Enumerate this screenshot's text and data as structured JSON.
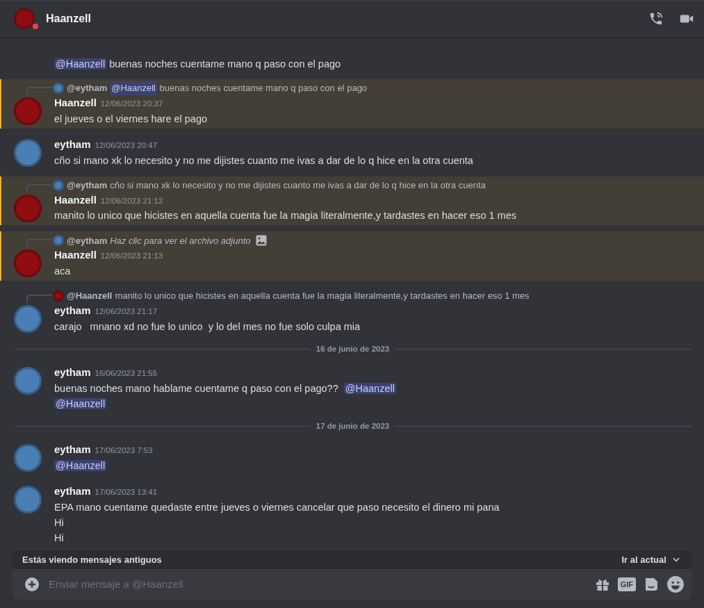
{
  "header": {
    "name": "Haanzell"
  },
  "messages": [
    {
      "kind": "continuation",
      "highlighted": false,
      "segments": [
        {
          "kind": "mention",
          "text": "@Haanzell"
        },
        {
          "kind": "text",
          "text": " buenas noches cuentame mano q paso con el pago"
        }
      ]
    },
    {
      "kind": "message",
      "highlighted": true,
      "avatar": {
        "color": "#8f0d10"
      },
      "author": "Haanzell",
      "timestamp": "12/06/2023 20:37",
      "reply": {
        "avatar": {
          "color": "#4a7fb5"
        },
        "author": "@eytham",
        "segments": [
          {
            "kind": "mention",
            "text": "@Haanzell"
          },
          {
            "kind": "text",
            "text": " buenas noches cuentame mano q paso con el pago"
          }
        ]
      },
      "lines": [
        [
          {
            "kind": "text",
            "text": "el jueves o el viernes hare el pago"
          }
        ]
      ]
    },
    {
      "kind": "message",
      "highlighted": false,
      "avatar": {
        "color": "#4a7fb5"
      },
      "author": "eytham",
      "timestamp": "12/06/2023 20:47",
      "lines": [
        [
          {
            "kind": "text",
            "text": "cño si mano xk lo necesito y no me dijistes cuanto me ivas a dar de lo q hice en la otra cuenta"
          }
        ]
      ]
    },
    {
      "kind": "message",
      "highlighted": true,
      "avatar": {
        "color": "#8f0d10"
      },
      "author": "Haanzell",
      "timestamp": "12/06/2023 21:12",
      "reply": {
        "avatar": {
          "color": "#4a7fb5"
        },
        "author": "@eytham",
        "segments": [
          {
            "kind": "text",
            "text": "cño si mano xk lo necesito y no me dijistes cuanto me ivas a dar de lo q hice en la otra cuenta"
          }
        ]
      },
      "lines": [
        [
          {
            "kind": "text",
            "text": "manito lo unico que hicistes en aquella cuenta fue la magia literalmente,y tardastes en hacer eso 1 mes"
          }
        ]
      ]
    },
    {
      "kind": "message",
      "highlighted": true,
      "avatar": {
        "color": "#8f0d10"
      },
      "author": "Haanzell",
      "timestamp": "12/06/2023 21:13",
      "reply": {
        "avatar": {
          "color": "#4a7fb5"
        },
        "author": "@eytham",
        "attachment_icon": true,
        "segments": [
          {
            "kind": "italic",
            "text": "Haz clic para ver el archivo adjunto"
          }
        ]
      },
      "lines": [
        [
          {
            "kind": "text",
            "text": "aca"
          }
        ]
      ]
    },
    {
      "kind": "message",
      "highlighted": false,
      "avatar": {
        "color": "#4a7fb5"
      },
      "author": "eytham",
      "timestamp": "12/06/2023 21:17",
      "reply": {
        "avatar": {
          "color": "#8f0d10"
        },
        "author": "@Haanzell",
        "segments": [
          {
            "kind": "text",
            "text": "manito lo unico que hicistes en aquella cuenta fue la magia literalmente,y tardastes en hacer eso 1 mes"
          }
        ]
      },
      "lines": [
        [
          {
            "kind": "text",
            "text": "carajo   mnano xd no fue lo unico  y lo del mes no fue solo culpa mia"
          }
        ]
      ]
    },
    {
      "kind": "divider",
      "text": "16 de junio de 2023"
    },
    {
      "kind": "message",
      "highlighted": false,
      "avatar": {
        "color": "#4a7fb5"
      },
      "author": "eytham",
      "timestamp": "16/06/2023 21:55",
      "lines": [
        [
          {
            "kind": "text",
            "text": "buenas noches mano hablame cuentame q paso con el pago??  "
          },
          {
            "kind": "mention",
            "text": "@Haanzell"
          }
        ],
        [
          {
            "kind": "mention",
            "text": "@Haanzell"
          }
        ]
      ]
    },
    {
      "kind": "divider",
      "text": "17 de junio de 2023"
    },
    {
      "kind": "message",
      "highlighted": false,
      "avatar": {
        "color": "#4a7fb5"
      },
      "author": "eytham",
      "timestamp": "17/06/2023 7:53",
      "lines": [
        [
          {
            "kind": "mention",
            "text": "@Haanzell"
          }
        ]
      ]
    },
    {
      "kind": "message",
      "highlighted": false,
      "avatar": {
        "color": "#4a7fb5"
      },
      "author": "eytham",
      "timestamp": "17/06/2023 13:41",
      "lines": [
        [
          {
            "kind": "text",
            "text": "EPA mano cuentame quedaste entre jueves o viernes cancelar que paso necesito el dinero mi pana"
          }
        ],
        [
          {
            "kind": "text",
            "text": "Hi"
          }
        ],
        [
          {
            "kind": "text",
            "text": "Hi"
          }
        ]
      ]
    }
  ],
  "old_messages_bar": {
    "text": "Estás viendo mensajes antiguos",
    "action": "Ir al actual"
  },
  "composer": {
    "placeholder": "Enviar mensaje a @Haanzell",
    "gif_label": "GIF"
  }
}
